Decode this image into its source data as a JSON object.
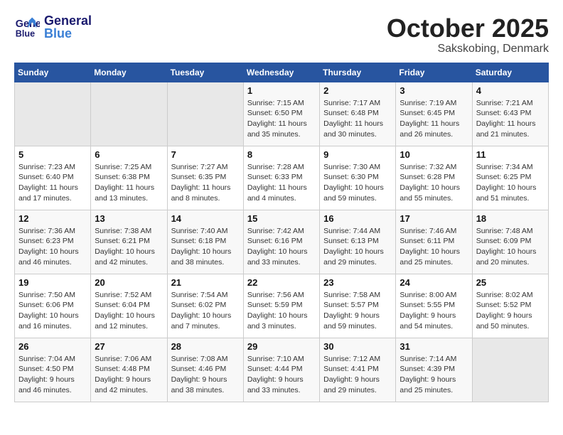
{
  "header": {
    "logo_line1": "General",
    "logo_line2": "Blue",
    "month": "October 2025",
    "location": "Sakskobing, Denmark"
  },
  "weekdays": [
    "Sunday",
    "Monday",
    "Tuesday",
    "Wednesday",
    "Thursday",
    "Friday",
    "Saturday"
  ],
  "weeks": [
    [
      {
        "day": "",
        "info": ""
      },
      {
        "day": "",
        "info": ""
      },
      {
        "day": "",
        "info": ""
      },
      {
        "day": "1",
        "info": "Sunrise: 7:15 AM\nSunset: 6:50 PM\nDaylight: 11 hours\nand 35 minutes."
      },
      {
        "day": "2",
        "info": "Sunrise: 7:17 AM\nSunset: 6:48 PM\nDaylight: 11 hours\nand 30 minutes."
      },
      {
        "day": "3",
        "info": "Sunrise: 7:19 AM\nSunset: 6:45 PM\nDaylight: 11 hours\nand 26 minutes."
      },
      {
        "day": "4",
        "info": "Sunrise: 7:21 AM\nSunset: 6:43 PM\nDaylight: 11 hours\nand 21 minutes."
      }
    ],
    [
      {
        "day": "5",
        "info": "Sunrise: 7:23 AM\nSunset: 6:40 PM\nDaylight: 11 hours\nand 17 minutes."
      },
      {
        "day": "6",
        "info": "Sunrise: 7:25 AM\nSunset: 6:38 PM\nDaylight: 11 hours\nand 13 minutes."
      },
      {
        "day": "7",
        "info": "Sunrise: 7:27 AM\nSunset: 6:35 PM\nDaylight: 11 hours\nand 8 minutes."
      },
      {
        "day": "8",
        "info": "Sunrise: 7:28 AM\nSunset: 6:33 PM\nDaylight: 11 hours\nand 4 minutes."
      },
      {
        "day": "9",
        "info": "Sunrise: 7:30 AM\nSunset: 6:30 PM\nDaylight: 10 hours\nand 59 minutes."
      },
      {
        "day": "10",
        "info": "Sunrise: 7:32 AM\nSunset: 6:28 PM\nDaylight: 10 hours\nand 55 minutes."
      },
      {
        "day": "11",
        "info": "Sunrise: 7:34 AM\nSunset: 6:25 PM\nDaylight: 10 hours\nand 51 minutes."
      }
    ],
    [
      {
        "day": "12",
        "info": "Sunrise: 7:36 AM\nSunset: 6:23 PM\nDaylight: 10 hours\nand 46 minutes."
      },
      {
        "day": "13",
        "info": "Sunrise: 7:38 AM\nSunset: 6:21 PM\nDaylight: 10 hours\nand 42 minutes."
      },
      {
        "day": "14",
        "info": "Sunrise: 7:40 AM\nSunset: 6:18 PM\nDaylight: 10 hours\nand 38 minutes."
      },
      {
        "day": "15",
        "info": "Sunrise: 7:42 AM\nSunset: 6:16 PM\nDaylight: 10 hours\nand 33 minutes."
      },
      {
        "day": "16",
        "info": "Sunrise: 7:44 AM\nSunset: 6:13 PM\nDaylight: 10 hours\nand 29 minutes."
      },
      {
        "day": "17",
        "info": "Sunrise: 7:46 AM\nSunset: 6:11 PM\nDaylight: 10 hours\nand 25 minutes."
      },
      {
        "day": "18",
        "info": "Sunrise: 7:48 AM\nSunset: 6:09 PM\nDaylight: 10 hours\nand 20 minutes."
      }
    ],
    [
      {
        "day": "19",
        "info": "Sunrise: 7:50 AM\nSunset: 6:06 PM\nDaylight: 10 hours\nand 16 minutes."
      },
      {
        "day": "20",
        "info": "Sunrise: 7:52 AM\nSunset: 6:04 PM\nDaylight: 10 hours\nand 12 minutes."
      },
      {
        "day": "21",
        "info": "Sunrise: 7:54 AM\nSunset: 6:02 PM\nDaylight: 10 hours\nand 7 minutes."
      },
      {
        "day": "22",
        "info": "Sunrise: 7:56 AM\nSunset: 5:59 PM\nDaylight: 10 hours\nand 3 minutes."
      },
      {
        "day": "23",
        "info": "Sunrise: 7:58 AM\nSunset: 5:57 PM\nDaylight: 9 hours\nand 59 minutes."
      },
      {
        "day": "24",
        "info": "Sunrise: 8:00 AM\nSunset: 5:55 PM\nDaylight: 9 hours\nand 54 minutes."
      },
      {
        "day": "25",
        "info": "Sunrise: 8:02 AM\nSunset: 5:52 PM\nDaylight: 9 hours\nand 50 minutes."
      }
    ],
    [
      {
        "day": "26",
        "info": "Sunrise: 7:04 AM\nSunset: 4:50 PM\nDaylight: 9 hours\nand 46 minutes."
      },
      {
        "day": "27",
        "info": "Sunrise: 7:06 AM\nSunset: 4:48 PM\nDaylight: 9 hours\nand 42 minutes."
      },
      {
        "day": "28",
        "info": "Sunrise: 7:08 AM\nSunset: 4:46 PM\nDaylight: 9 hours\nand 38 minutes."
      },
      {
        "day": "29",
        "info": "Sunrise: 7:10 AM\nSunset: 4:44 PM\nDaylight: 9 hours\nand 33 minutes."
      },
      {
        "day": "30",
        "info": "Sunrise: 7:12 AM\nSunset: 4:41 PM\nDaylight: 9 hours\nand 29 minutes."
      },
      {
        "day": "31",
        "info": "Sunrise: 7:14 AM\nSunset: 4:39 PM\nDaylight: 9 hours\nand 25 minutes."
      },
      {
        "day": "",
        "info": ""
      }
    ]
  ]
}
